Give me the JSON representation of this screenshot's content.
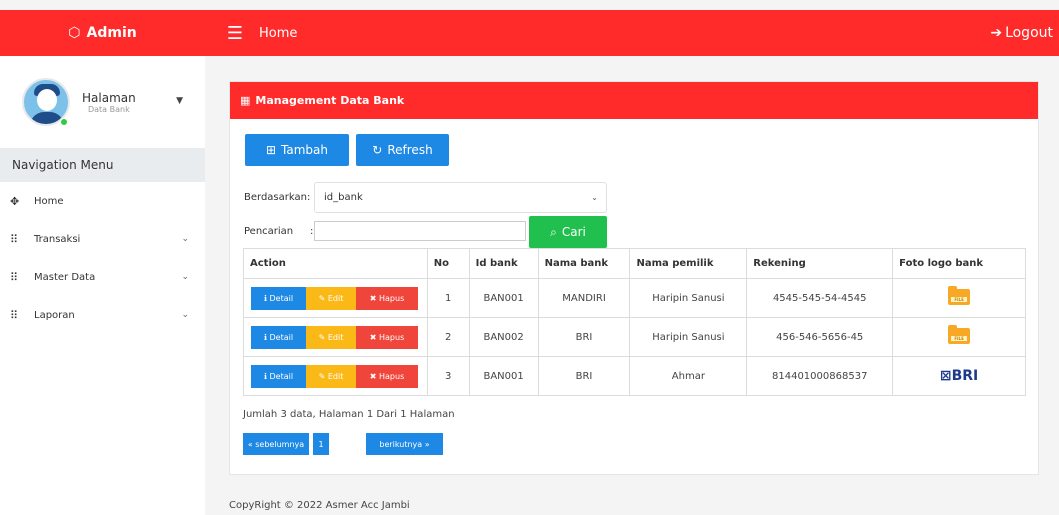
{
  "topbar": {
    "brand": "Admin",
    "title": "Home",
    "logout": "Logout"
  },
  "user": {
    "name": "Halaman",
    "sub": "Data Bank"
  },
  "nav": {
    "header": "Navigation Menu",
    "items": [
      {
        "label": "Home",
        "icon": "move-icon",
        "has_chevron": false
      },
      {
        "label": "Transaksi",
        "icon": "grid-icon",
        "has_chevron": true
      },
      {
        "label": "Master Data",
        "icon": "grid-icon",
        "has_chevron": true
      },
      {
        "label": "Laporan",
        "icon": "grid-icon",
        "has_chevron": true
      }
    ]
  },
  "card": {
    "title": "Management Data Bank",
    "btn_tambah": "Tambah",
    "btn_refresh": "Refresh",
    "filter_label": "Berdasarkan:",
    "filter_value": "id_bank",
    "search_label": "Pencarian",
    "search_sep": ":",
    "search_value": "",
    "btn_cari": "Cari"
  },
  "table": {
    "headers": [
      "Action",
      "No",
      "Id bank",
      "Nama bank",
      "Nama pemilik",
      "Rekening",
      "Foto logo bank"
    ],
    "actions": {
      "detail": "Detail",
      "edit": "Edit",
      "hapus": "Hapus"
    },
    "rows": [
      {
        "no": "1",
        "id": "BAN001",
        "bank": "MANDIRI",
        "owner": "Haripin Sanusi",
        "rek": "4545-545-54-4545",
        "logo": "file"
      },
      {
        "no": "2",
        "id": "BAN002",
        "bank": "BRI",
        "owner": "Haripin Sanusi",
        "rek": "456-546-5656-45",
        "logo": "file"
      },
      {
        "no": "3",
        "id": "BAN001",
        "bank": "BRI",
        "owner": "Ahmar",
        "rek": "814401000868537",
        "logo": "bri"
      }
    ],
    "logo_file_text": "FILE",
    "logo_bri_text": "BRI"
  },
  "summary": "Jumlah 3 data, Halaman 1 Dari 1 Halaman",
  "pager": {
    "prev": "« sebelumnya",
    "page": "1",
    "next": "berikutnya »"
  },
  "footer": "CopyRight © 2022 Asmer Acc Jambi",
  "colors": {
    "primary_red": "#ff2a2a",
    "blue": "#1e88e5",
    "green": "#21c04e",
    "yellow": "#fbb917",
    "danger": "#f0453a"
  }
}
